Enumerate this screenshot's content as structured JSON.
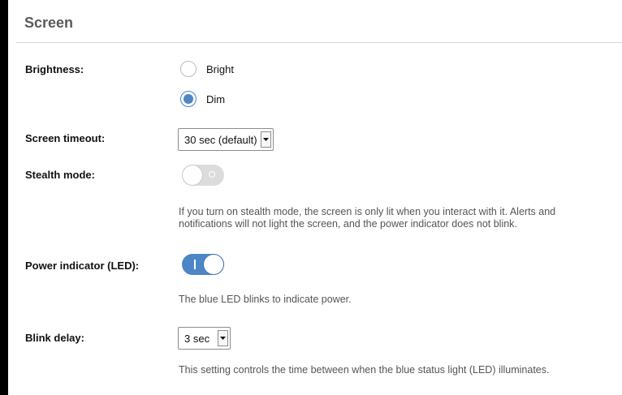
{
  "section": {
    "title": "Screen"
  },
  "brightness": {
    "label": "Brightness:",
    "options": [
      {
        "label": "Bright",
        "checked": false
      },
      {
        "label": "Dim",
        "checked": true
      }
    ]
  },
  "screen_timeout": {
    "label": "Screen timeout:",
    "selected": "30 sec (default)"
  },
  "stealth_mode": {
    "label": "Stealth mode:",
    "state": "off",
    "description": "If you turn on stealth mode, the screen is only lit when you interact with it. Alerts and notifications will not light the screen, and the power indicator does not blink."
  },
  "power_indicator": {
    "label": "Power indicator (LED):",
    "state": "on",
    "description": "The blue LED blinks to indicate power."
  },
  "blink_delay": {
    "label": "Blink delay:",
    "selected": "3 sec",
    "description": "This setting controls the time between when the blue status light (LED) illuminates."
  },
  "colors": {
    "accent": "#4d86c4",
    "title": "#5a5a5a",
    "toggle_off": "#dcdcdc"
  },
  "icons": {
    "dropdown_arrow": "triangle-down-icon"
  }
}
